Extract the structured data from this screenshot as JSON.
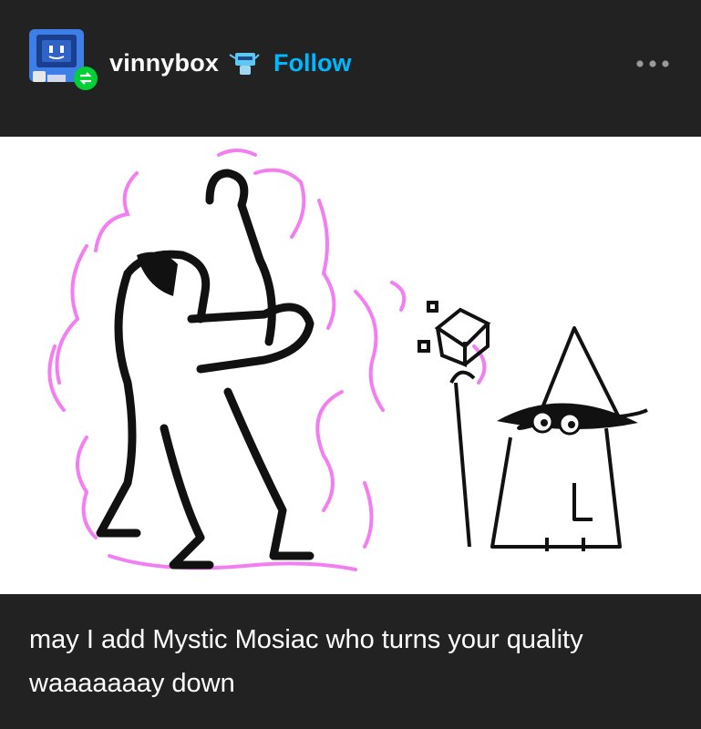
{
  "post": {
    "author": "vinnybox",
    "follow_label": "Follow",
    "more_menu_icon": "ellipsis-icon",
    "reblog_badge_icon": "reblog-icon",
    "blog_badge_icon": "robot-badge-icon",
    "caption": "may I add Mystic Mosiac who turns your quality waaaaaaay down"
  },
  "colors": {
    "background": "#222222",
    "follow": "#00b8ff",
    "reblog_badge": "#00cf35",
    "aura": "#f27ef2"
  }
}
